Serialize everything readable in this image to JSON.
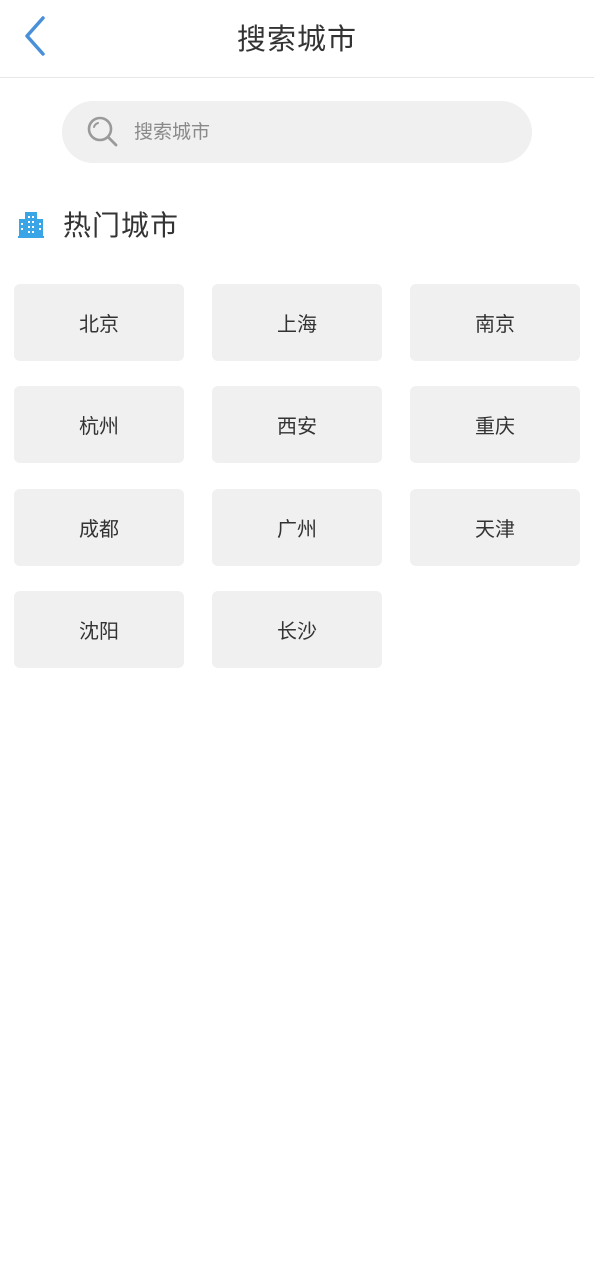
{
  "header": {
    "title": "搜索城市",
    "back_icon": "chevron-left-icon",
    "accent_color": "#4a90d9"
  },
  "search": {
    "placeholder": "搜索城市",
    "value": "",
    "icon": "search-icon"
  },
  "hot_cities": {
    "title": "热门城市",
    "icon": "building-icon",
    "icon_color": "#3aa5e6",
    "cities": [
      "北京",
      "上海",
      "南京",
      "杭州",
      "西安",
      "重庆",
      "成都",
      "广州",
      "天津",
      "沈阳",
      "长沙"
    ]
  }
}
